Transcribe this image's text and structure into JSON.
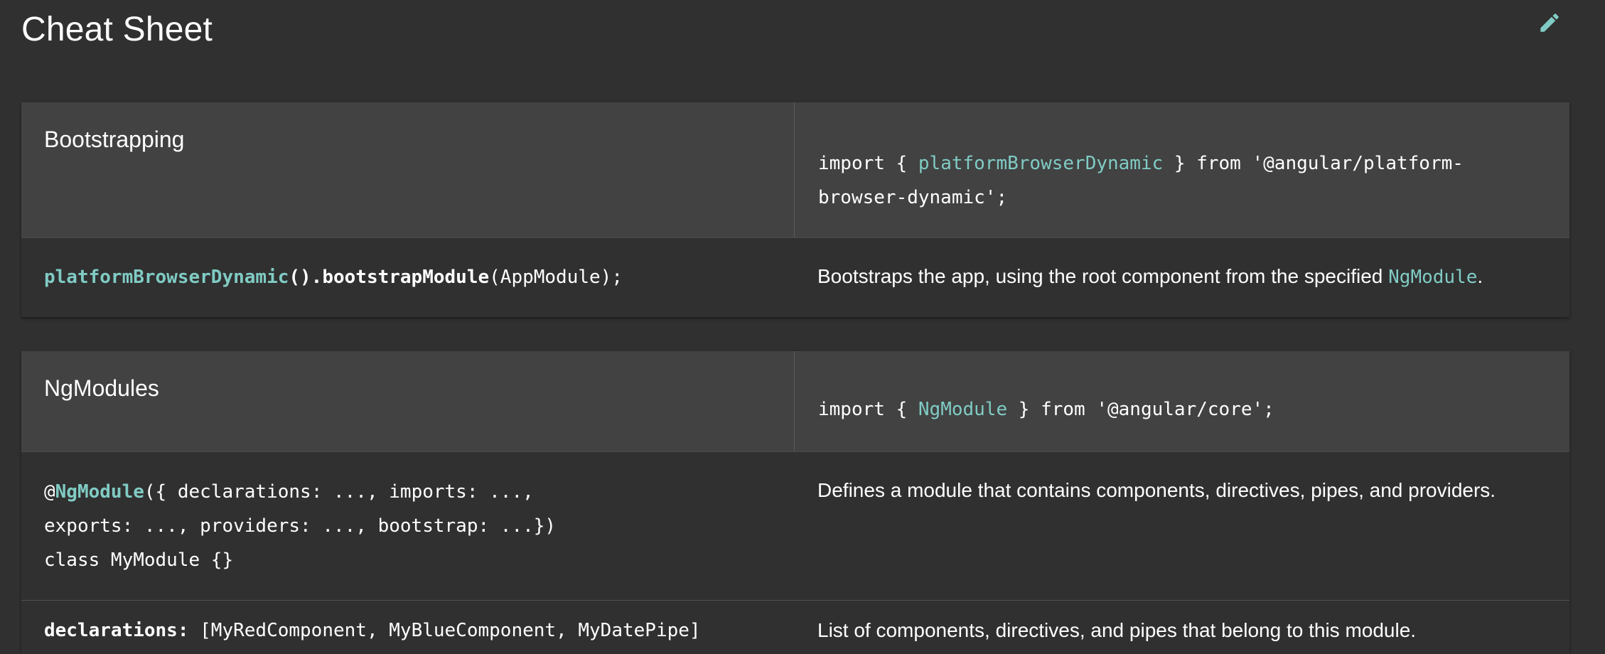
{
  "page": {
    "title": "Cheat Sheet"
  },
  "icons": {
    "edit": "pencil-icon"
  },
  "colors": {
    "background": "#303030",
    "header_row": "#424242",
    "accent": "#80cbc4",
    "text": "#ffffff"
  },
  "sections": [
    {
      "title": "Bootstrapping",
      "import": {
        "pre": "import { ",
        "symbol": "platformBrowserDynamic",
        "post_line1": " } from '@angular/platform-",
        "line2": "browser-dynamic';"
      },
      "rows": [
        {
          "syntax": {
            "hl": "platformBrowserDynamic",
            "bold": "().bootstrapModule",
            "rest": "(AppModule);"
          },
          "desc": {
            "pre": "Bootstraps the app, using the root component from the specified ",
            "hl": "NgModule",
            "post": "."
          }
        }
      ]
    },
    {
      "title": "NgModules",
      "import": {
        "pre": "import { ",
        "symbol": "NgModule",
        "post": " } from '@angular/core';"
      },
      "rows": [
        {
          "syntax": {
            "at": "@",
            "hl": "NgModule",
            "line1_rest": "({ declarations: ..., imports: ...,",
            "line2": "exports: ..., providers: ..., bootstrap: ...})",
            "line3": "class MyModule {}"
          },
          "desc": {
            "text": "Defines a module that contains components, directives, pipes, and providers."
          }
        },
        {
          "syntax": {
            "bold": "declarations:",
            "rest": " [MyRedComponent, MyBlueComponent, MyDatePipe]"
          },
          "desc": {
            "text": "List of components, directives, and pipes that belong to this module."
          }
        }
      ]
    }
  ]
}
